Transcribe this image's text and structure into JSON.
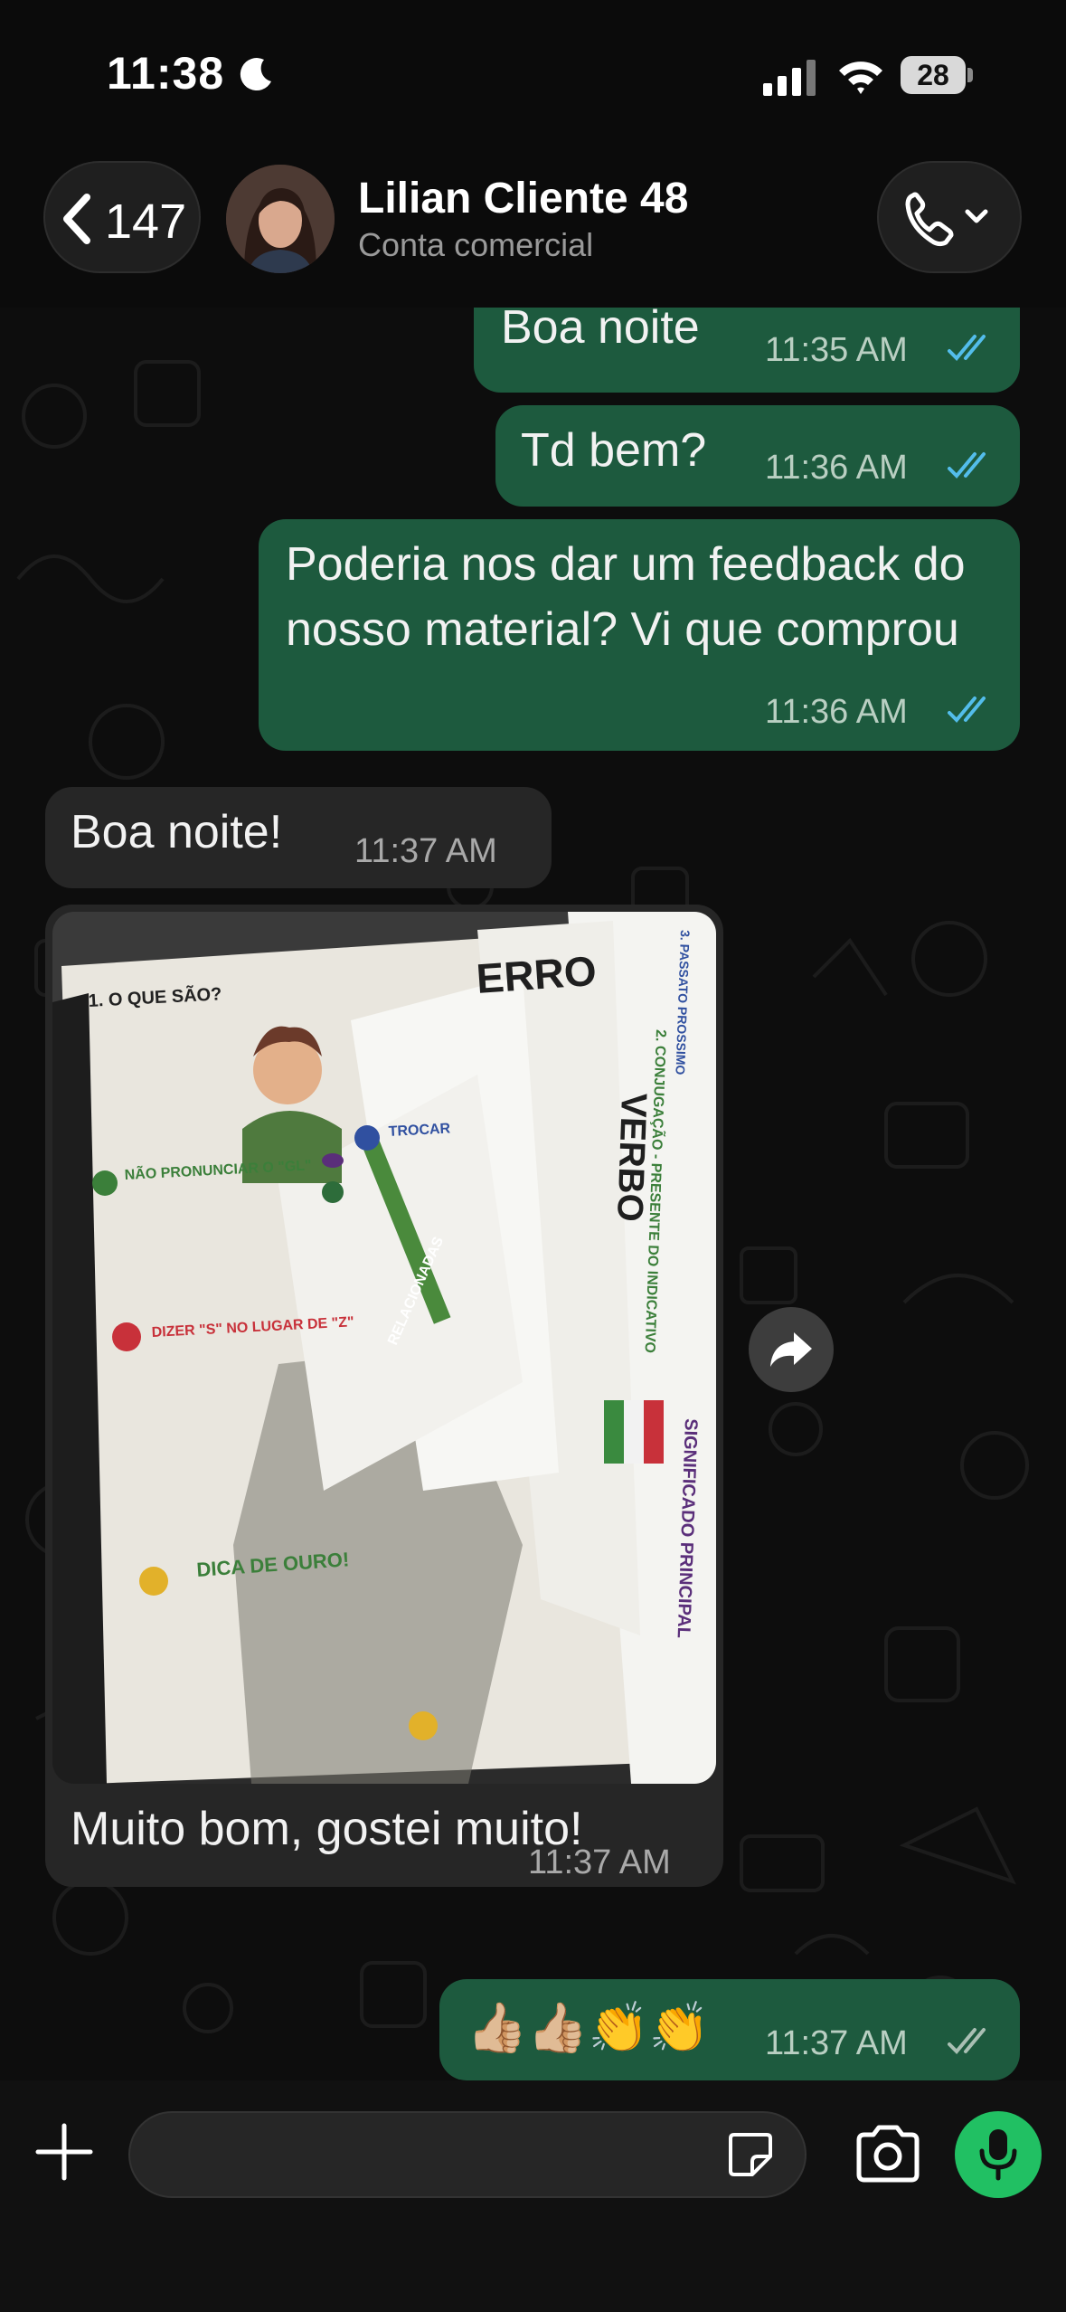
{
  "status_bar": {
    "time": "11:38",
    "battery": "28"
  },
  "header": {
    "back_count": "147",
    "contact_name": "Lilian Cliente 48",
    "contact_subtitle": "Conta comercial"
  },
  "messages": [
    {
      "direction": "outgoing",
      "text": "Boa noite",
      "time": "11:35 AM",
      "status": "read"
    },
    {
      "direction": "outgoing",
      "text": "Td bem?",
      "time": "11:36 AM",
      "status": "read"
    },
    {
      "direction": "outgoing",
      "text": "Poderia nos dar um feedback do nosso material? Vi que comprou",
      "time": "11:36 AM",
      "status": "read"
    },
    {
      "direction": "incoming",
      "text": "Boa noite!",
      "time": "11:37 AM"
    },
    {
      "direction": "incoming",
      "type": "image",
      "caption": "Muito bom, gostei muito!",
      "time": "11:37 AM"
    },
    {
      "direction": "outgoing",
      "text": "👍🏼👍🏼👏👏",
      "time": "11:37 AM",
      "status": "delivered"
    }
  ],
  "photo_text": {
    "title_1": "1. O QUE SÃO?",
    "item_1": "NÃO PRONUNCIAR O \"GL\"",
    "item_2": "TROCAR",
    "item_6": "DIZER \"S\" NO LUGAR DE \"Z\"",
    "tip": "DICA DE OURO!",
    "erro": "ERRO",
    "verbo": "VERBO",
    "conj": "2. CONJUGAÇÃO - PRESENTE DO INDICATIVO",
    "pass": "3. PASSATO PROSSIMO",
    "signif": "SIGNIFICADO PRINCIPAL",
    "relac": "RELACIONADAS"
  },
  "colors": {
    "outgoing_bubble": "#1d5a3e",
    "incoming_bubble": "#262626",
    "read_ticks": "#53bdeb",
    "mic_button": "#21c063"
  }
}
